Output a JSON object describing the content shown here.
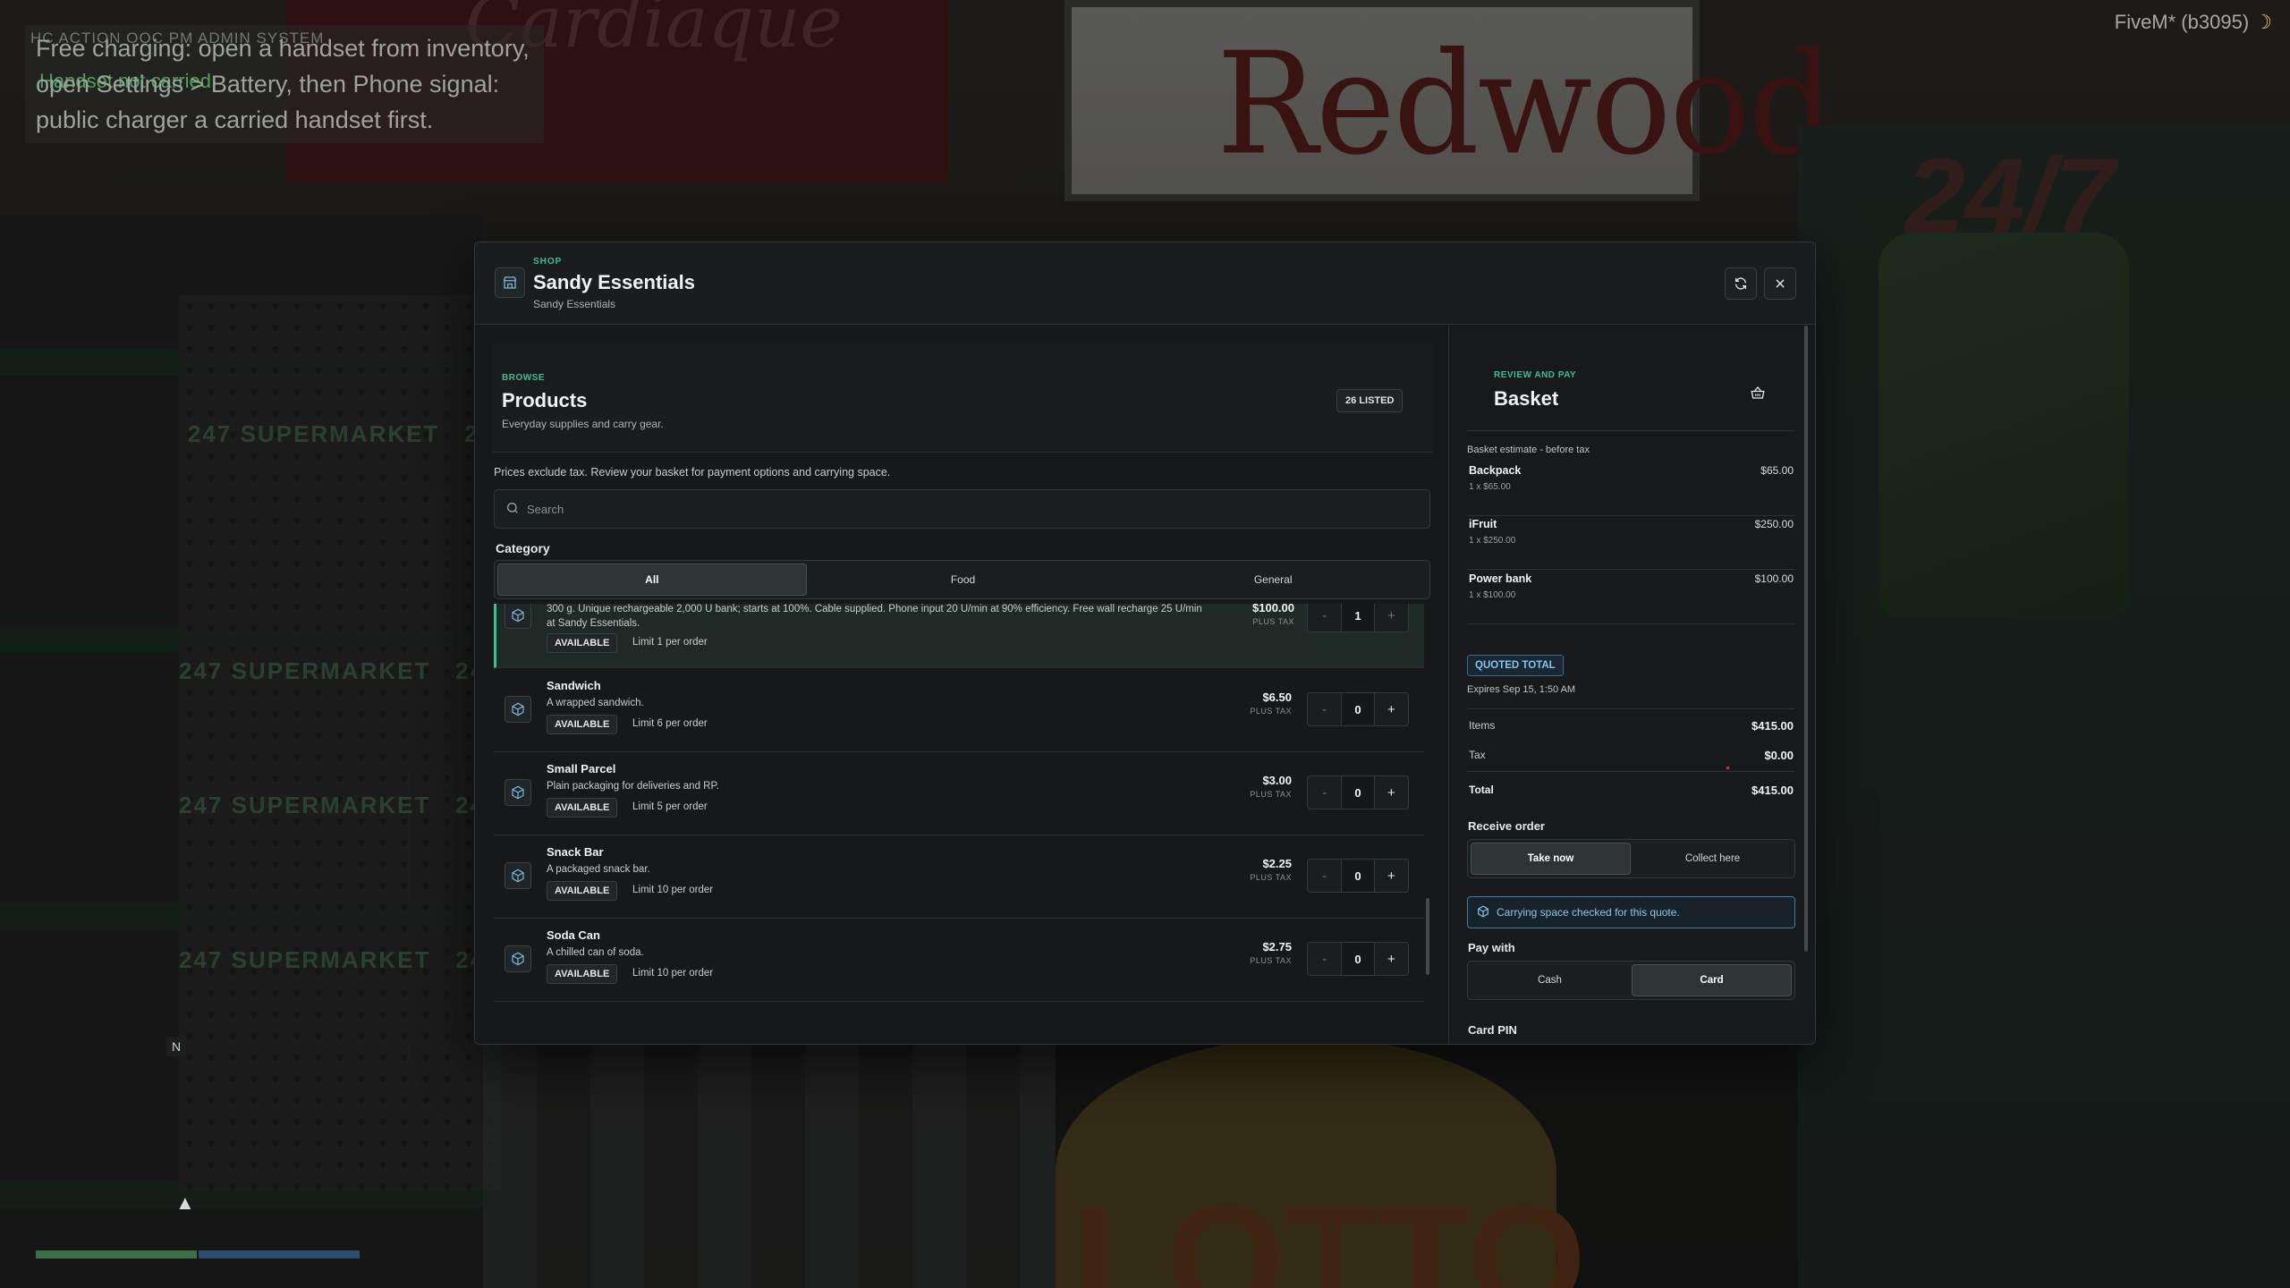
{
  "hud": {
    "tabs": "HC  ACTION  OOC  PM  ADMIN  SYSTEM",
    "charging_note": "Free charging: open a handset from inventory, open Settings > Battery, then Phone signal: public charger a carried handset first.",
    "green_note": "Handset not carried",
    "client": "FiveM* (b3095)",
    "minimap_marker": "N"
  },
  "shop": {
    "kicker": "SHOP",
    "title": "Sandy Essentials",
    "subtitle": "Sandy Essentials"
  },
  "products": {
    "kicker": "BROWSE",
    "title": "Products",
    "subtitle": "Everyday supplies and carry gear.",
    "listed_badge": "26 LISTED",
    "note": "Prices exclude tax. Review your basket for payment options and carrying space.",
    "search_placeholder": "Search",
    "category_label": "Category",
    "categories": [
      {
        "label": "All",
        "active": true
      },
      {
        "label": "Food",
        "active": false
      },
      {
        "label": "General",
        "active": false
      }
    ],
    "items": [
      {
        "name": "",
        "desc": "300 g. Unique rechargeable 2,000 U bank; starts at 100%. Cable supplied. Phone input 20 U/min at 90% efficiency. Free wall recharge 25 U/min at Sandy Essentials.",
        "status": "AVAILABLE",
        "limit": "Limit 1 per order",
        "price": "$100.00",
        "tax": "PLUS TAX",
        "qty": "1",
        "selected": true
      },
      {
        "name": "Sandwich",
        "desc": "A wrapped sandwich.",
        "status": "AVAILABLE",
        "limit": "Limit 6 per order",
        "price": "$6.50",
        "tax": "PLUS TAX",
        "qty": "0"
      },
      {
        "name": "Small Parcel",
        "desc": "Plain packaging for deliveries and RP.",
        "status": "AVAILABLE",
        "limit": "Limit 5 per order",
        "price": "$3.00",
        "tax": "PLUS TAX",
        "qty": "0"
      },
      {
        "name": "Snack Bar",
        "desc": "A packaged snack bar.",
        "status": "AVAILABLE",
        "limit": "Limit 10 per order",
        "price": "$2.25",
        "tax": "PLUS TAX",
        "qty": "0"
      },
      {
        "name": "Soda Can",
        "desc": "A chilled can of soda.",
        "status": "AVAILABLE",
        "limit": "Limit 10 per order",
        "price": "$2.75",
        "tax": "PLUS TAX",
        "qty": "0"
      }
    ],
    "minus": "-",
    "plus": "+"
  },
  "basket": {
    "kicker": "REVIEW AND PAY",
    "title": "Basket",
    "estimate": "Basket estimate - before tax",
    "items": [
      {
        "name": "Backpack",
        "qty": "1 x $65.00",
        "price": "$65.00"
      },
      {
        "name": "iFruit",
        "qty": "1 x $250.00",
        "price": "$250.00"
      },
      {
        "name": "Power bank",
        "qty": "1 x $100.00",
        "price": "$100.00"
      }
    ],
    "quoted_badge": "QUOTED TOTAL",
    "expires": "Expires Sep 15, 1:50 AM",
    "totals": {
      "items_label": "Items",
      "items_value": "$415.00",
      "tax_label": "Tax",
      "tax_value": "$0.00",
      "total_label": "Total",
      "total_value": "$415.00"
    },
    "receive_label": "Receive order",
    "receive_options": [
      {
        "label": "Take now",
        "active": true
      },
      {
        "label": "Collect here",
        "active": false
      }
    ],
    "carry_info": "Carrying space checked for this quote.",
    "pay_label": "Pay with",
    "pay_options": [
      {
        "label": "Cash",
        "active": false
      },
      {
        "label": "Card",
        "active": true
      }
    ],
    "pin_label": "Card PIN"
  },
  "colors": {
    "accent": "#3fbf8f",
    "info": "#8cc8ea",
    "panel": "#161819"
  }
}
